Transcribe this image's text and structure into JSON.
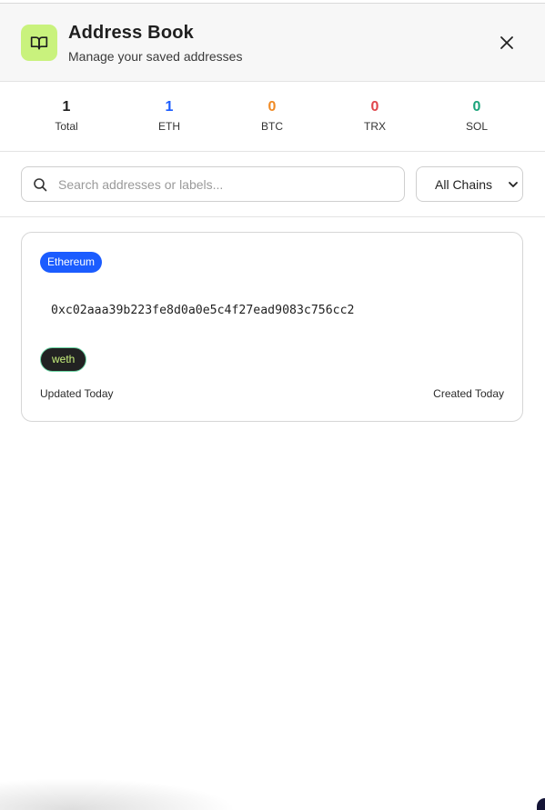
{
  "header": {
    "title": "Address Book",
    "subtitle": "Manage your saved addresses",
    "logo_icon": "book-open-icon",
    "close_icon": "close-icon"
  },
  "stats": [
    {
      "value": "1",
      "label": "Total",
      "color": "#1f1f1f"
    },
    {
      "value": "1",
      "label": "ETH",
      "color": "#1b5cff"
    },
    {
      "value": "0",
      "label": "BTC",
      "color": "#f08a24"
    },
    {
      "value": "0",
      "label": "TRX",
      "color": "#e0454b"
    },
    {
      "value": "0",
      "label": "SOL",
      "color": "#1aa37a"
    }
  ],
  "toolbar": {
    "search_placeholder": "Search addresses or labels...",
    "search_value": "",
    "chain_filter": "All Chains"
  },
  "addresses": [
    {
      "chain": "Ethereum",
      "address": "0xc02aaa39b223fe8d0a0e5c4f27ead9083c756cc2",
      "label": "weth",
      "updated": "Updated Today",
      "created": "Created Today"
    }
  ],
  "colors": {
    "accent": "#c9f27d",
    "chain_badge": "#1b5cff"
  }
}
